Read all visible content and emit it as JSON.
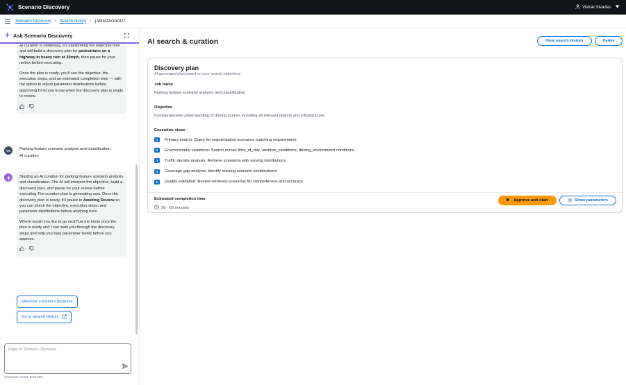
{
  "app": {
    "title": "Scenario Discovery",
    "user_name": "Vishak Sivadas"
  },
  "breadcrumb": {
    "items": [
      "Scenario Discovery",
      "Search history"
    ],
    "current": "j-WmOzv1bOU7"
  },
  "left_panel": {
    "title": "Ask Scenario Discovery",
    "msg1": {
      "p1_a": "AI curation is underway. It's interpreting the objective now and will build a discovery plan for",
      "p1_bold": "pedestrians on a highway in heavy rain at 30mph",
      "p1_b": ", then pause for your review before executing.",
      "p2": "Once the plan is ready, you'll see the objective, the execution steps, and an estimated completion time — with the option to adjust parameter distributions before approving.I'll let you know when the discovery plan is ready to review."
    },
    "user_avatar": "VS",
    "user_msg": {
      "line1": "Parking feature scenario analysis and classification",
      "line2": "AI curation"
    },
    "msg2": {
      "p1_a": "Starting an AI curation for parking-feature scenario analysis and classification. The AI will interpret the objective, build a discovery plan, and pause for your review before executing.The curation plan is generating now. Once the discovery plan is ready, it'll pause in",
      "p1_bold": "Awaiting Review",
      "p1_b": "so you can check the objective, execution steps, and parameter distributions before anything runs.",
      "p2": "Where would you like to go next?Let me know once the plan is ready and I can walk you through the discovery steps and help you tune parameter levels before you approve."
    },
    "btn_progress": "View this curation's progress",
    "btn_history": "Go to Search History",
    "reply_placeholder": "Reply to Scenario Discovery",
    "char_count": "Character count: 0/10,000"
  },
  "main": {
    "title": "AI search & curation",
    "btn_view_history": "View search history",
    "btn_delete": "Delete",
    "plan": {
      "title": "Discovery plan",
      "subtitle": "AI-generated plan based on your search objectives",
      "job_label": "Job name",
      "job_value": "Parking feature scenario analysis and classification",
      "objective_label": "Objective",
      "objective_value": "Comprehensive understanding of driving scenes including all relevant objects and infrastructure",
      "steps_label": "Execution steps",
      "steps": [
        {
          "num": "1",
          "text": "Primary search: Query for segmentation scenarios matching requirements"
        },
        {
          "num": "2",
          "text": "Environmental variations: Search across time_of_day, weather_conditions, driving_environment conditions"
        },
        {
          "num": "3",
          "text": "Traffic density analysis: Retrieve scenarios with varying distributions"
        },
        {
          "num": "4",
          "text": "Coverage gap analysis: Identify missing scenario combinations"
        },
        {
          "num": "5",
          "text": "Quality validation: Review retrieved scenarios for completeness and accuracy"
        }
      ],
      "time_label": "Estimated completion time",
      "time_value": "30 - 60 minutes",
      "btn_approve": "Approve and start",
      "btn_params": "Show parameters"
    }
  },
  "colors": {
    "primary": "#0972d3",
    "accent_orange": "#ff9900",
    "topbar": "#0f141a",
    "ai_purple": "#7d5fd8"
  }
}
